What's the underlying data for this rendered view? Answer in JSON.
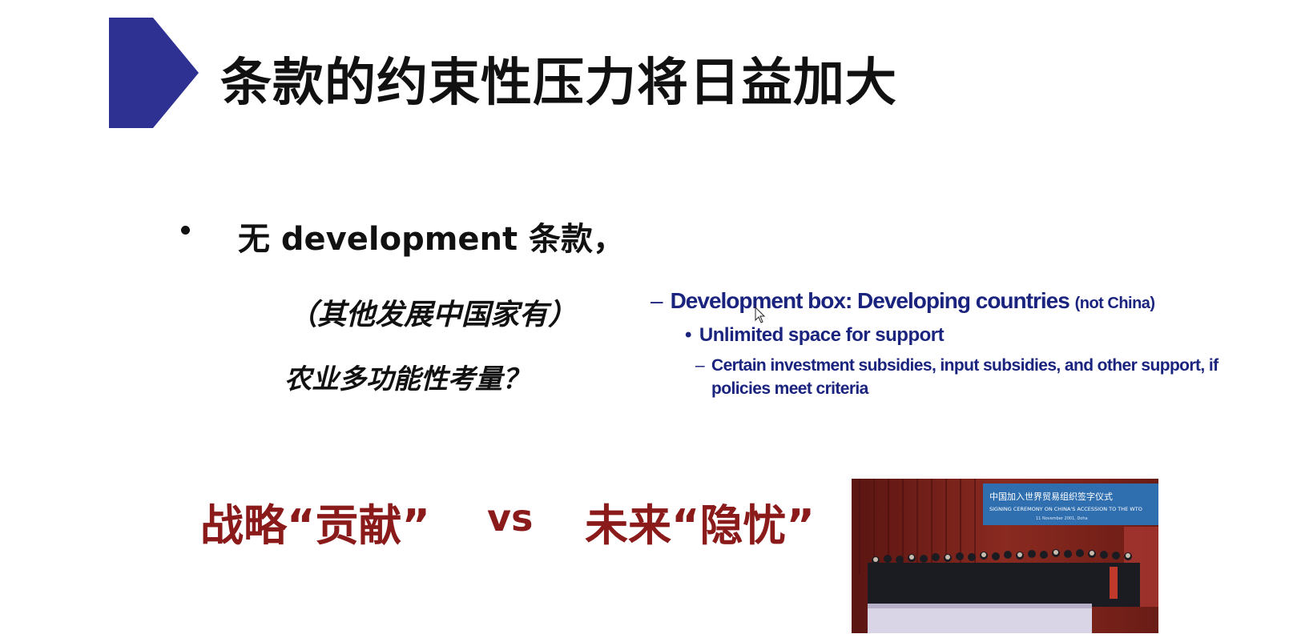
{
  "slide": {
    "title": "条款的约束性压力将日益加大",
    "accent_color": "#2e3192",
    "bullet": "无 development 条款，",
    "note_line_1": "（其他发展中国家有）",
    "note_line_2": "农业多功能性考量？",
    "dev_box": {
      "heading_dash": "–",
      "heading": "Development  box: Developing countries",
      "heading_small": "(not China)",
      "level2_bullet": "•",
      "level2": "Unlimited space for support",
      "level3_dash": "–",
      "level3_line_1": "Certain investment subsidies, input subsidies, and other support, if",
      "level3_line_2": "policies meet criteria",
      "text_color": "#1a237e"
    },
    "contrast": {
      "left": "战略“贡献”",
      "vs": "vs",
      "right": "未来“隐忧”",
      "color": "#8b1a1a"
    },
    "photo": {
      "banner_text_cn": "中国加入世界贸易组织签字仪式",
      "banner_text_en": "SIGNING CEREMONY ON CHINA'S ACCESSION TO THE WTO",
      "banner_date": "11 November 2001, Doha"
    }
  }
}
